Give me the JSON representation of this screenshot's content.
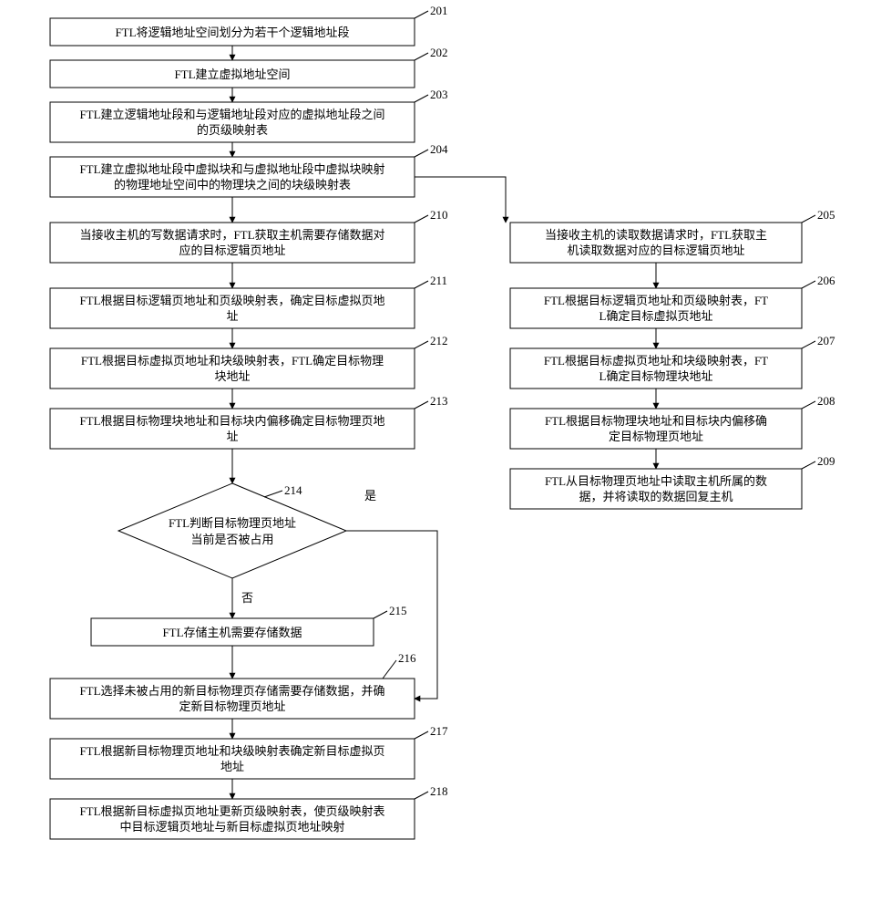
{
  "chart_data": {
    "type": "flowchart",
    "title": "",
    "nodes": [
      {
        "id": "201",
        "text": "FTL将逻辑地址空间划分为若干个逻辑地址段"
      },
      {
        "id": "202",
        "text": "FTL建立虚拟地址空间"
      },
      {
        "id": "203",
        "text": "FTL建立逻辑地址段和与逻辑地址段对应的虚拟地址段之间的页级映射表"
      },
      {
        "id": "204",
        "text": "FTL建立虚拟地址段中虚拟块和与虚拟地址段中虚拟块映射的物理地址空间中的物理块之间的块级映射表"
      },
      {
        "id": "205",
        "text": "当接收主机的读取数据请求时，FTL获取主机读取数据对应的目标逻辑页地址"
      },
      {
        "id": "206",
        "text": "FTL根据目标逻辑页地址和页级映射表，FTL确定目标虚拟页地址"
      },
      {
        "id": "207",
        "text": "FTL根据目标虚拟页地址和块级映射表，FTL确定目标物理块地址"
      },
      {
        "id": "208",
        "text": "FTL根据目标物理块地址和目标块内偏移确定目标物理页地址"
      },
      {
        "id": "209",
        "text": "FTL从目标物理页地址中读取主机所属的数据，并将读取的数据回复主机"
      },
      {
        "id": "210",
        "text": "当接收主机的写数据请求时，FTL获取主机需要存储数据对应的目标逻辑页地址"
      },
      {
        "id": "211",
        "text": "FTL根据目标逻辑页地址和页级映射表，确定目标虚拟页地址"
      },
      {
        "id": "212",
        "text": "FTL根据目标虚拟页地址和块级映射表，FTL确定目标物理块地址"
      },
      {
        "id": "213",
        "text": "FTL根据目标物理块地址和目标块内偏移确定目标物理页地址"
      },
      {
        "id": "214",
        "text": "FTL判断目标物理页地址当前是否被占用",
        "type": "decision",
        "yes": "是",
        "no": "否"
      },
      {
        "id": "215",
        "text": "FTL存储主机需要存储数据"
      },
      {
        "id": "216",
        "text": "FTL选择未被占用的新目标物理页存储需要存储数据，并确定新目标物理页地址"
      },
      {
        "id": "217",
        "text": "FTL根据新目标物理页地址和块级映射表确定新目标虚拟页地址"
      },
      {
        "id": "218",
        "text": "FTL根据新目标虚拟页地址更新页级映射表，使页级映射表中目标逻辑页地址与新目标虚拟页地址映射"
      }
    ],
    "edges": [
      [
        "201",
        "202"
      ],
      [
        "202",
        "203"
      ],
      [
        "203",
        "204"
      ],
      [
        "204",
        "210"
      ],
      [
        "204",
        "205"
      ],
      [
        "210",
        "211"
      ],
      [
        "211",
        "212"
      ],
      [
        "212",
        "213"
      ],
      [
        "213",
        "214"
      ],
      [
        "214",
        "215",
        "否"
      ],
      [
        "214",
        "216",
        "是"
      ],
      [
        "215",
        "216"
      ],
      [
        "216",
        "217"
      ],
      [
        "217",
        "218"
      ],
      [
        "205",
        "206"
      ],
      [
        "206",
        "207"
      ],
      [
        "207",
        "208"
      ],
      [
        "208",
        "209"
      ]
    ]
  },
  "nodes": {
    "n201": {
      "num": "201",
      "l1": "FTL将逻辑地址空间划分为若干个逻辑地址段"
    },
    "n202": {
      "num": "202",
      "l1": "FTL建立虚拟地址空间"
    },
    "n203": {
      "num": "203",
      "l1": "FTL建立逻辑地址段和与逻辑地址段对应的虚拟地址段之间",
      "l2": "的页级映射表"
    },
    "n204": {
      "num": "204",
      "l1": "FTL建立虚拟地址段中虚拟块和与虚拟地址段中虚拟块映射",
      "l2": "的物理地址空间中的物理块之间的块级映射表"
    },
    "n210": {
      "num": "210",
      "l1": "当接收主机的写数据请求时，FTL获取主机需要存储数据对",
      "l2": "应的目标逻辑页地址"
    },
    "n211": {
      "num": "211",
      "l1": "FTL根据目标逻辑页地址和页级映射表，确定目标虚拟页地",
      "l2": "址"
    },
    "n212": {
      "num": "212",
      "l1": "FTL根据目标虚拟页地址和块级映射表，FTL确定目标物理",
      "l2": "块地址"
    },
    "n213": {
      "num": "213",
      "l1": "FTL根据目标物理块地址和目标块内偏移确定目标物理页地",
      "l2": "址"
    },
    "n214": {
      "num": "214",
      "l1": "FTL判断目标物理页地址",
      "l2": "当前是否被占用",
      "yes": "是",
      "no": "否"
    },
    "n215": {
      "num": "215",
      "l1": "FTL存储主机需要存储数据"
    },
    "n216": {
      "num": "216",
      "l1": "FTL选择未被占用的新目标物理页存储需要存储数据，并确",
      "l2": "定新目标物理页地址"
    },
    "n217": {
      "num": "217",
      "l1": "FTL根据新目标物理页地址和块级映射表确定新目标虚拟页",
      "l2": "地址"
    },
    "n218": {
      "num": "218",
      "l1": "FTL根据新目标虚拟页地址更新页级映射表，使页级映射表",
      "l2": "中目标逻辑页地址与新目标虚拟页地址映射"
    },
    "n205": {
      "num": "205",
      "l1": "当接收主机的读取数据请求时，FTL获取主",
      "l2": "机读取数据对应的目标逻辑页地址"
    },
    "n206": {
      "num": "206",
      "l1": "FTL根据目标逻辑页地址和页级映射表，FT",
      "l2": "L确定目标虚拟页地址"
    },
    "n207": {
      "num": "207",
      "l1": "FTL根据目标虚拟页地址和块级映射表，FT",
      "l2": "L确定目标物理块地址"
    },
    "n208": {
      "num": "208",
      "l1": "FTL根据目标物理块地址和目标块内偏移确",
      "l2": "定目标物理页地址"
    },
    "n209": {
      "num": "209",
      "l1": "FTL从目标物理页地址中读取主机所属的数",
      "l2": "据，并将读取的数据回复主机"
    }
  }
}
